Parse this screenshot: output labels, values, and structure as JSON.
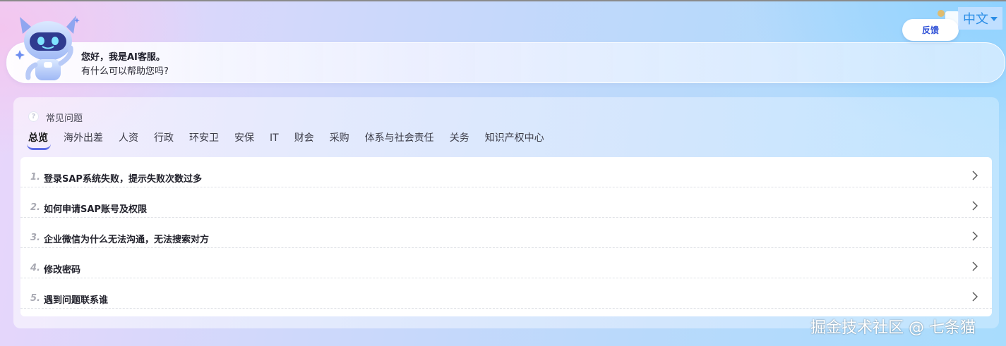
{
  "greeting": {
    "line1": "您好，我是AI客服。",
    "line2": "有什么可以帮助您吗?"
  },
  "header": {
    "feedback_label": "反馈",
    "language": "中文"
  },
  "faq": {
    "title": "常见问题",
    "title_icon": "question-icon",
    "tabs": [
      {
        "label": "总览",
        "active": true
      },
      {
        "label": "海外出差"
      },
      {
        "label": "人资"
      },
      {
        "label": "行政"
      },
      {
        "label": "环安卫"
      },
      {
        "label": "安保"
      },
      {
        "label": "IT"
      },
      {
        "label": "财会"
      },
      {
        "label": "采购"
      },
      {
        "label": "体系与社会责任"
      },
      {
        "label": "关务"
      },
      {
        "label": "知识产权中心"
      }
    ],
    "questions": [
      {
        "num": "1.",
        "text": "登录SAP系统失败，提示失败次数过多"
      },
      {
        "num": "2.",
        "text": "如何申请SAP账号及权限"
      },
      {
        "num": "3.",
        "text": "企业微信为什么无法沟通，无法搜索对方"
      },
      {
        "num": "4.",
        "text": "修改密码"
      },
      {
        "num": "5.",
        "text": "遇到问题联系谁"
      }
    ]
  },
  "watermark": "掘金技术社区 @ 七条猫",
  "colors": {
    "accent": "#5b6be6",
    "feedback_text": "#2d4fd6",
    "lang_text": "#2a8de6"
  },
  "icons": {
    "robot": "robot-mascot-icon",
    "row_arrow": "chevron-right-icon",
    "lang_caret": "caret-down-icon"
  }
}
